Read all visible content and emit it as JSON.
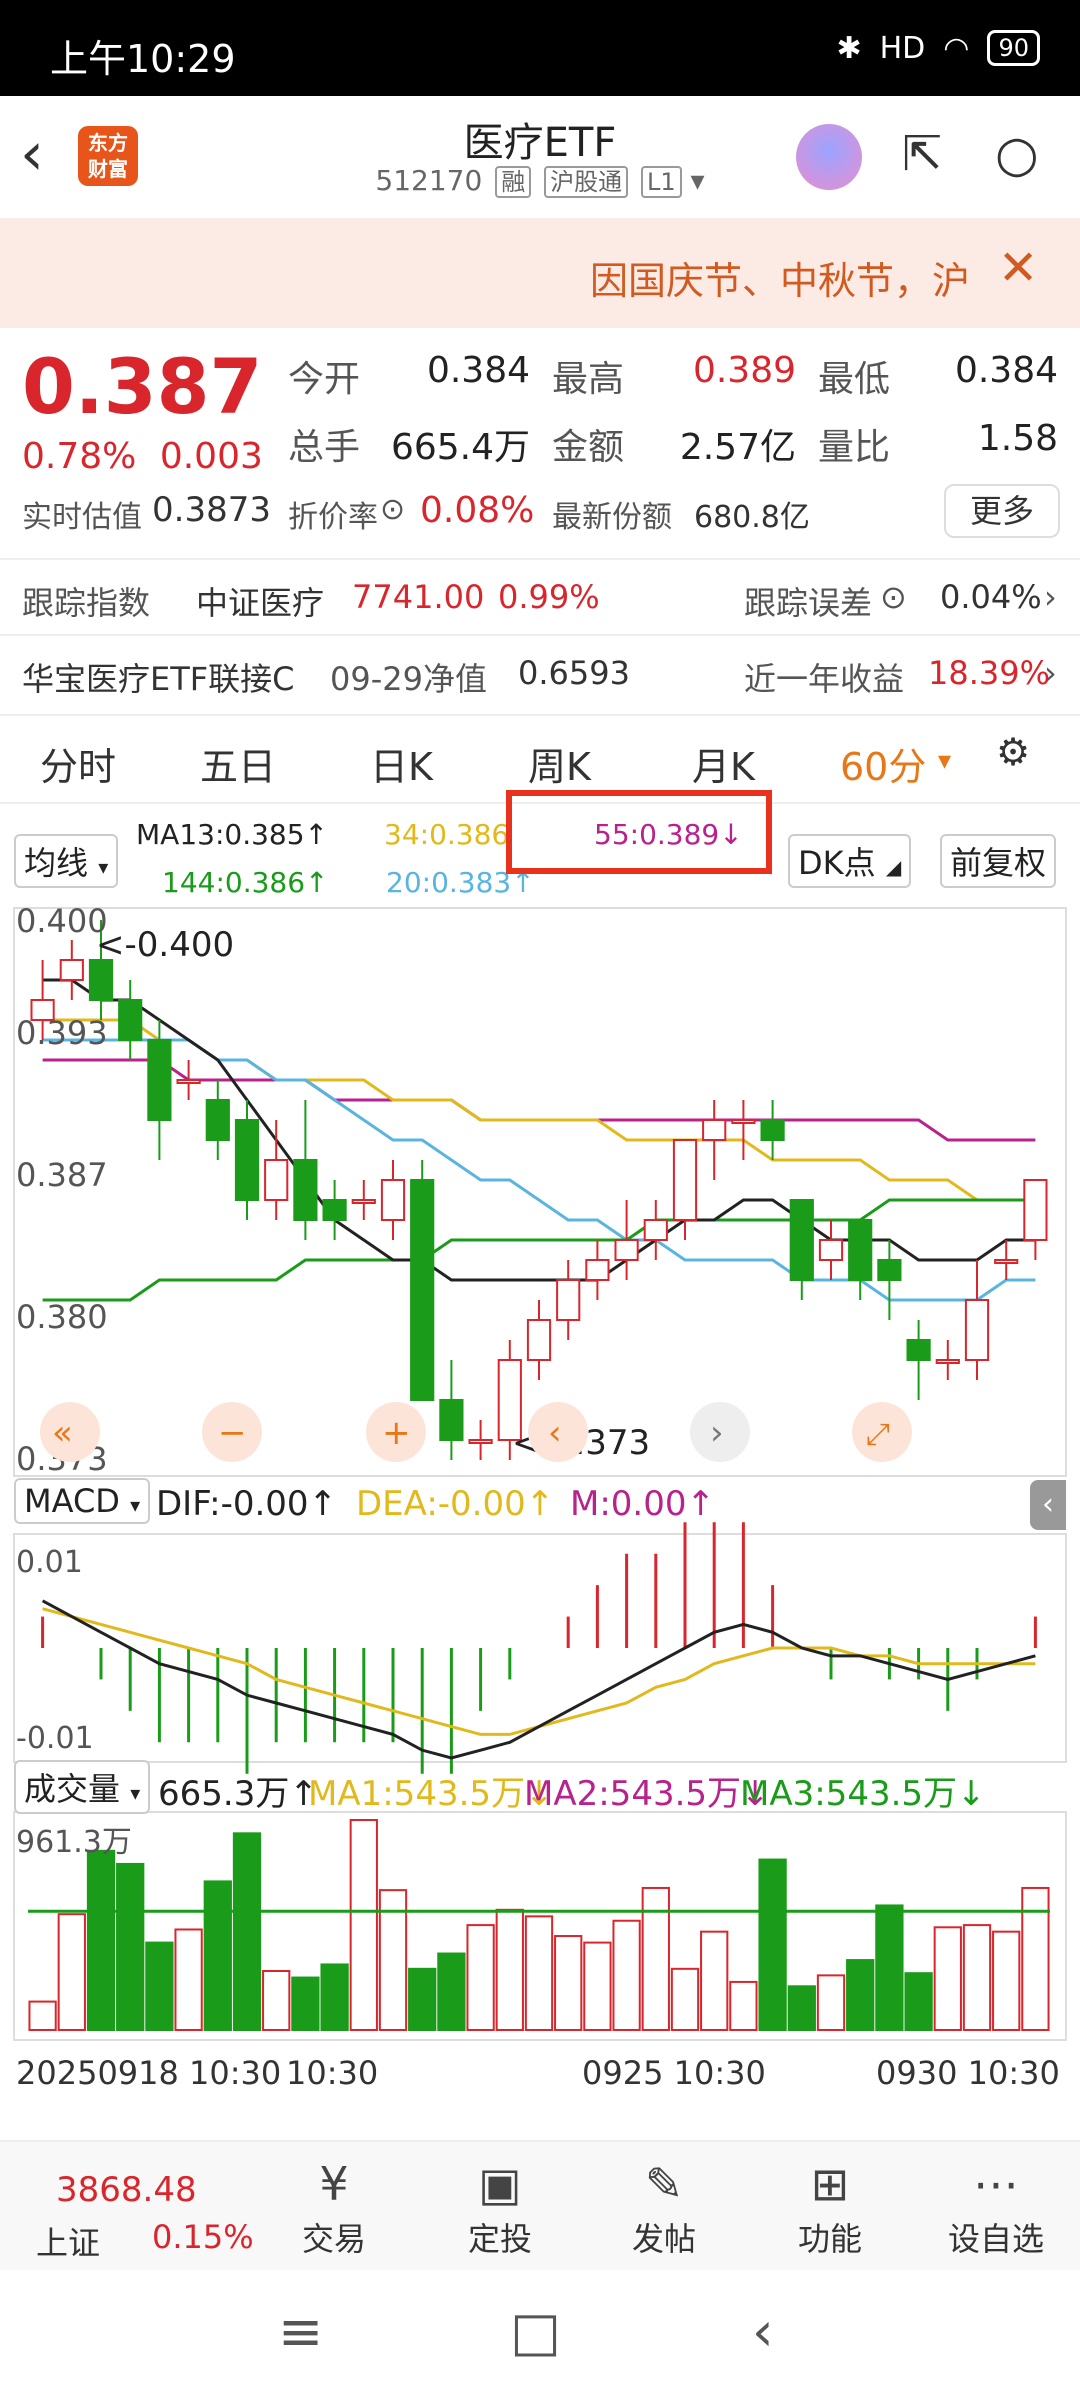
{
  "status": {
    "time": "上午10:29",
    "alarm_icon": "alarm-icon",
    "bt_icon": "bluetooth-icon",
    "signal": "HD",
    "battery": "90"
  },
  "header": {
    "title": "医疗ETF",
    "code": "512170",
    "tag1": "融",
    "tag2": "沪股通",
    "tag3": "L1",
    "logo": "东方\n财富"
  },
  "banner": {
    "text": "因国庆节、中秋节，沪",
    "close": "✕"
  },
  "quote": {
    "price": "0.387",
    "change_pct": "0.78%",
    "change": "0.003",
    "open_label": "今开",
    "open": "0.384",
    "high_label": "最高",
    "high": "0.389",
    "low_label": "最低",
    "low": "0.384",
    "vol_label": "总手",
    "vol": "665.4万",
    "amount_label": "金额",
    "amount": "2.57亿",
    "ratio_label": "量比",
    "ratio": "1.58",
    "est_label": "实时估值",
    "est": "0.3873",
    "disc_label": "折价率",
    "disc": "0.08%",
    "share_label": "最新份额",
    "share": "680.8亿",
    "more": "更多"
  },
  "info1": {
    "label": "跟踪指数",
    "name": "中证医疗",
    "val": "7741.00",
    "pct": "0.99%",
    "err_label": "跟踪误差",
    "err": "0.04%"
  },
  "info2": {
    "name": "华宝医疗ETF联接C",
    "date": "09-29净值",
    "nav": "0.6593",
    "ret_label": "近一年收益",
    "ret": "18.39%"
  },
  "tabs": [
    "分时",
    "五日",
    "日K",
    "周K",
    "月K",
    "60分"
  ],
  "ma": {
    "type": "均线",
    "ma13": "MA13:0.385↑",
    "ma34": "34:0.386",
    "ma55": "55:0.389↓",
    "ma144": "144:0.386↑",
    "ma20": "20:0.383↑",
    "dk": "DK点",
    "fq": "前复权"
  },
  "chart_labels": {
    "p1": "0.400",
    "p2": "0.393",
    "p3": "0.387",
    "p4": "0.380",
    "p5": "0.373",
    "hi": "<-0.400",
    "lo": "<-0.373"
  },
  "macd": {
    "name": "MACD",
    "dif": "DIF:-0.00↑",
    "dea": "DEA:-0.00↑",
    "m": "M:0.00↑",
    "top": "0.01",
    "bot": "-0.01"
  },
  "vol": {
    "name": "成交量",
    "v": "665.3万↑",
    "ma1": "MA1:543.5万↓",
    "ma2": "MA2:543.5万↓",
    "ma3": "MA3:543.5万↓",
    "max": "961.3万"
  },
  "dates": {
    "d1": "20250918 10:30",
    "d1b": "10:30",
    "d2": "0925 10:30",
    "d3": "0930 10:30"
  },
  "bottom": {
    "idx": "3868.48",
    "idx_name": "上证",
    "idx_chg": "0.15%",
    "items": [
      "交易",
      "定投",
      "发帖",
      "功能",
      "设自选"
    ]
  },
  "colors": {
    "up": "#d9262c",
    "down": "#1a9c1a",
    "accent": "#e87817"
  },
  "chart_data": {
    "type": "candlestick",
    "ylim": [
      0.373,
      0.4
    ],
    "candles": [
      [
        0.395,
        0.396,
        0.398,
        0.394
      ],
      [
        0.397,
        0.398,
        0.399,
        0.396
      ],
      [
        0.398,
        0.396,
        0.4,
        0.395
      ],
      [
        0.396,
        0.394,
        0.397,
        0.393
      ],
      [
        0.394,
        0.39,
        0.395,
        0.388
      ],
      [
        0.392,
        0.392,
        0.393,
        0.391
      ],
      [
        0.391,
        0.389,
        0.392,
        0.388
      ],
      [
        0.39,
        0.386,
        0.391,
        0.385
      ],
      [
        0.386,
        0.388,
        0.39,
        0.385
      ],
      [
        0.388,
        0.385,
        0.391,
        0.384
      ],
      [
        0.386,
        0.385,
        0.387,
        0.384
      ],
      [
        0.386,
        0.386,
        0.387,
        0.385
      ],
      [
        0.385,
        0.387,
        0.388,
        0.384
      ],
      [
        0.387,
        0.376,
        0.388,
        0.376
      ],
      [
        0.376,
        0.374,
        0.378,
        0.373
      ],
      [
        0.374,
        0.374,
        0.375,
        0.373
      ],
      [
        0.374,
        0.378,
        0.379,
        0.373
      ],
      [
        0.378,
        0.38,
        0.381,
        0.377
      ],
      [
        0.38,
        0.382,
        0.383,
        0.379
      ],
      [
        0.382,
        0.383,
        0.384,
        0.381
      ],
      [
        0.383,
        0.384,
        0.386,
        0.382
      ],
      [
        0.384,
        0.385,
        0.386,
        0.383
      ],
      [
        0.385,
        0.389,
        0.389,
        0.384
      ],
      [
        0.389,
        0.39,
        0.391,
        0.387
      ],
      [
        0.39,
        0.39,
        0.391,
        0.388
      ],
      [
        0.39,
        0.389,
        0.391,
        0.388
      ],
      [
        0.386,
        0.382,
        0.386,
        0.381
      ],
      [
        0.383,
        0.384,
        0.385,
        0.382
      ],
      [
        0.385,
        0.382,
        0.385,
        0.381
      ],
      [
        0.383,
        0.382,
        0.384,
        0.38
      ],
      [
        0.379,
        0.378,
        0.38,
        0.376
      ],
      [
        0.378,
        0.378,
        0.379,
        0.377
      ],
      [
        0.378,
        0.381,
        0.383,
        0.377
      ],
      [
        0.383,
        0.383,
        0.384,
        0.382
      ],
      [
        0.384,
        0.387,
        0.387,
        0.383
      ]
    ],
    "ma13": [
      0.397,
      0.397,
      0.396,
      0.396,
      0.395,
      0.394,
      0.393,
      0.391,
      0.389,
      0.387,
      0.385,
      0.384,
      0.383,
      0.383,
      0.382,
      0.382,
      0.382,
      0.382,
      0.382,
      0.382,
      0.383,
      0.384,
      0.385,
      0.385,
      0.386,
      0.386,
      0.385,
      0.384,
      0.384,
      0.384,
      0.383,
      0.383,
      0.383,
      0.384,
      0.384
    ],
    "ma34": [
      0.395,
      0.395,
      0.395,
      0.395,
      0.394,
      0.394,
      0.393,
      0.393,
      0.392,
      0.392,
      0.392,
      0.392,
      0.391,
      0.391,
      0.391,
      0.39,
      0.39,
      0.39,
      0.39,
      0.39,
      0.389,
      0.389,
      0.389,
      0.389,
      0.389,
      0.388,
      0.388,
      0.388,
      0.388,
      0.387,
      0.387,
      0.387,
      0.386,
      0.386,
      0.386
    ],
    "ma55": [
      0.393,
      0.393,
      0.393,
      0.393,
      0.393,
      0.392,
      0.392,
      0.392,
      0.392,
      0.392,
      0.391,
      0.391,
      0.391,
      0.391,
      0.391,
      0.39,
      0.39,
      0.39,
      0.39,
      0.39,
      0.39,
      0.39,
      0.39,
      0.39,
      0.39,
      0.39,
      0.39,
      0.39,
      0.39,
      0.39,
      0.39,
      0.389,
      0.389,
      0.389,
      0.389
    ],
    "ma144": [
      0.381,
      0.381,
      0.381,
      0.381,
      0.382,
      0.382,
      0.382,
      0.382,
      0.382,
      0.383,
      0.383,
      0.383,
      0.383,
      0.383,
      0.384,
      0.384,
      0.384,
      0.384,
      0.384,
      0.384,
      0.384,
      0.385,
      0.385,
      0.385,
      0.385,
      0.385,
      0.385,
      0.385,
      0.385,
      0.386,
      0.386,
      0.386,
      0.386,
      0.386,
      0.386
    ],
    "ma20": [
      0.394,
      0.394,
      0.394,
      0.394,
      0.394,
      0.394,
      0.393,
      0.393,
      0.392,
      0.392,
      0.391,
      0.39,
      0.389,
      0.389,
      0.388,
      0.387,
      0.387,
      0.386,
      0.385,
      0.385,
      0.384,
      0.384,
      0.383,
      0.383,
      0.383,
      0.383,
      0.382,
      0.382,
      0.382,
      0.381,
      0.381,
      0.381,
      0.381,
      0.382,
      0.382
    ],
    "macd_dif": [
      0.006,
      0.004,
      0.002,
      0.0,
      -0.002,
      -0.003,
      -0.004,
      -0.006,
      -0.007,
      -0.008,
      -0.009,
      -0.01,
      -0.011,
      -0.013,
      -0.014,
      -0.013,
      -0.012,
      -0.01,
      -0.008,
      -0.006,
      -0.004,
      -0.002,
      0.0,
      0.002,
      0.003,
      0.002,
      0.0,
      -0.001,
      -0.001,
      -0.002,
      -0.003,
      -0.004,
      -0.003,
      -0.002,
      -0.001
    ],
    "macd_dea": [
      0.005,
      0.004,
      0.003,
      0.002,
      0.001,
      0.0,
      -0.001,
      -0.002,
      -0.004,
      -0.005,
      -0.006,
      -0.007,
      -0.008,
      -0.009,
      -0.01,
      -0.011,
      -0.011,
      -0.01,
      -0.009,
      -0.008,
      -0.007,
      -0.005,
      -0.004,
      -0.002,
      -0.001,
      0.0,
      0.0,
      0.0,
      -0.001,
      -0.001,
      -0.002,
      -0.002,
      -0.002,
      -0.002,
      -0.002
    ],
    "macd_m": [
      0.001,
      0.0,
      -0.001,
      -0.002,
      -0.003,
      -0.003,
      -0.003,
      -0.004,
      -0.003,
      -0.003,
      -0.003,
      -0.003,
      -0.003,
      -0.004,
      -0.004,
      -0.002,
      -0.001,
      0.0,
      0.001,
      0.002,
      0.003,
      0.003,
      0.004,
      0.004,
      0.004,
      0.002,
      0.0,
      -0.001,
      0.0,
      -0.001,
      -0.001,
      -0.002,
      -0.001,
      0.0,
      0.001
    ],
    "volume": [
      130,
      530,
      820,
      760,
      400,
      460,
      680,
      900,
      270,
      240,
      300,
      961,
      640,
      280,
      350,
      480,
      550,
      520,
      430,
      400,
      500,
      650,
      280,
      450,
      220,
      780,
      200,
      250,
      320,
      570,
      260,
      470,
      480,
      450,
      650
    ],
    "vol_ma": 543.5
  }
}
